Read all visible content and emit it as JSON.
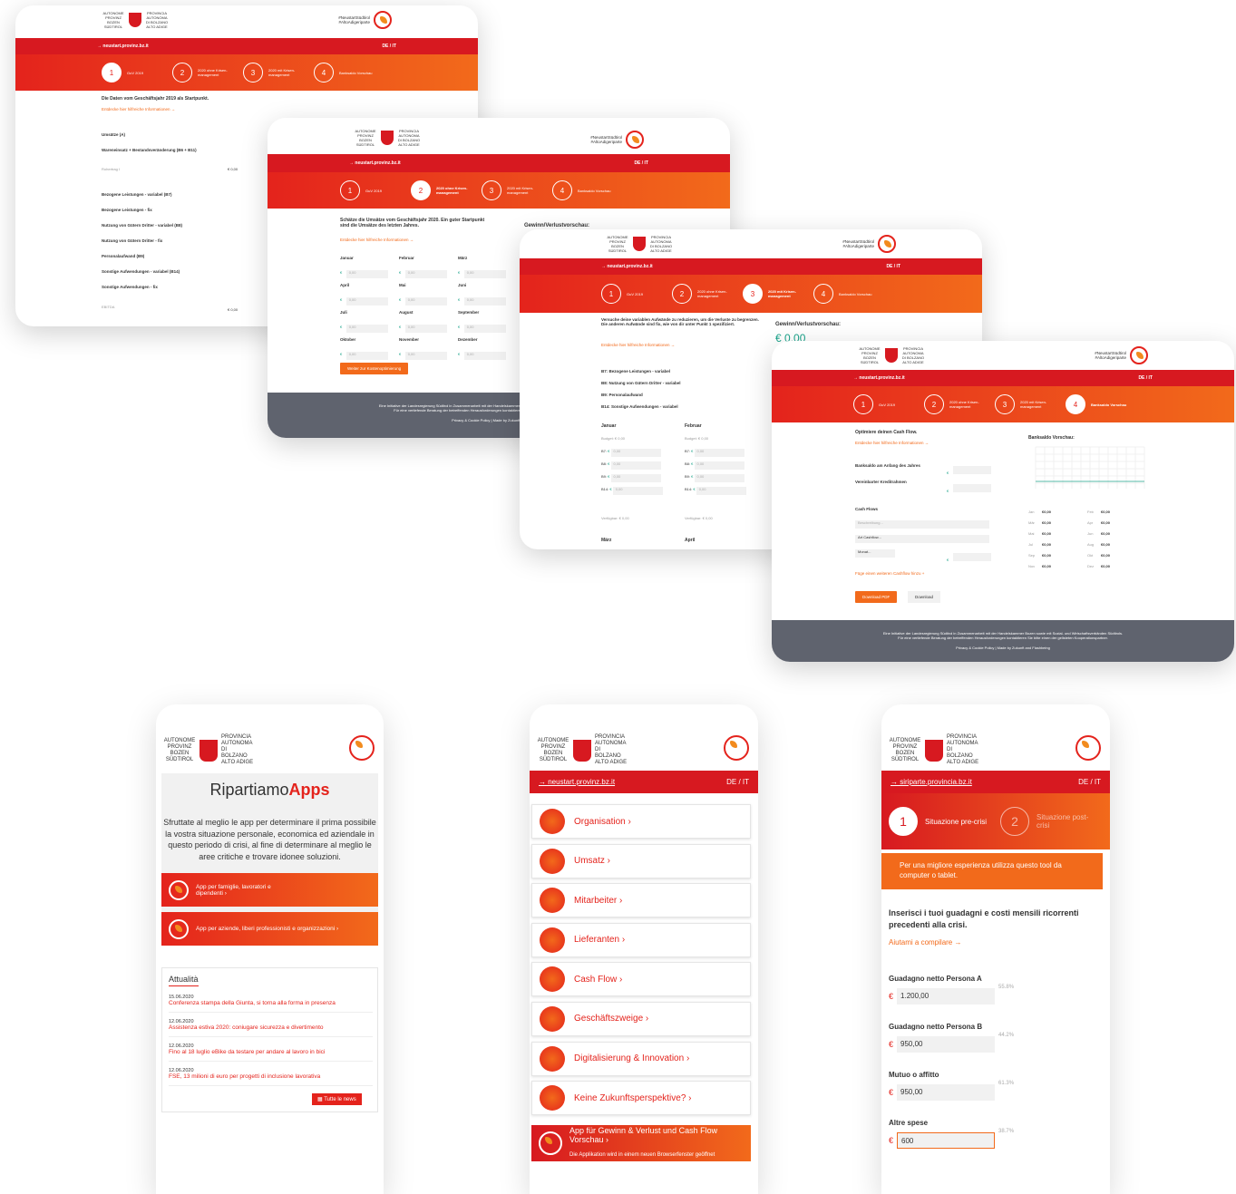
{
  "common": {
    "logo_de": "AUTONOME PROVINZ BOZEN SÜDTIROL",
    "logo_it": "PROVINCIA AUTONOMA DI BOLZANO ALTO ADIGE",
    "brand_line1": "#NeustartSüdtirol",
    "brand_line2": "#AltoAdigeriparte",
    "url": "→ neustart.provinz.bz.it",
    "lang": "DE / IT",
    "footer1": "Eine Initiative der Landesregierung Südtirol in Zusammenarbeit mit der Handelskammer Bozen sowie mit Sozial- und Wirtschaftsverbänden Südtirols.",
    "footer2": "Für eine vertiefende Beratung der betreffenden Herausforderungen kontaktieren Sie bitte einen der gelisteten Kooperationspartner.",
    "footer3": "Privacy & Cookie Policy | Made by Zukunft and Flashbeing",
    "cur": "€",
    "zero": "0,00",
    "info_link": "Entdecke hier hilfreiche Informationen →"
  },
  "steps": [
    {
      "n": "1",
      "label": "GuV 2019"
    },
    {
      "n": "2",
      "label": "2020 ohne Krisen-management"
    },
    {
      "n": "3",
      "label": "2020 mit Krisen-management"
    },
    {
      "n": "4",
      "label": "Banksaldo Vorschau"
    }
  ],
  "s1": {
    "heading": "Die Daten vom Geschäftsjahr 2019 als Startpunkt.",
    "rows": [
      "Umsätze (A)",
      "Wareneinsatz + Bestandsveränderung (B6 + B11)",
      "Rohertrag I",
      "Bezogene Leistungen - variabel (B7)",
      "Bezogene Leistungen - fix",
      "Nutzung von Gütern Dritter - variabel (B8)",
      "Nutzung von Gütern Dritter - fix",
      "Personalaufwand (B9)",
      "Sonstige Aufwendungen - variabel (B14)",
      "Sonstige Aufwendungen - fix",
      "EBITDA"
    ],
    "total": "€ 0,00"
  },
  "s2": {
    "heading": "Schätze die Umsätze vom Geschäftsjahr 2020. Ein guter Startpunkt sind die Umsätze des letzten Jahres.",
    "preview": "Gewinn/Verlustvorschau:",
    "months": [
      "Januar",
      "Februar",
      "März",
      "April",
      "Mai",
      "Juni",
      "Juli",
      "August",
      "September",
      "Oktober",
      "November",
      "Dezember"
    ],
    "button": "Weiter zur Kostenoptimierung"
  },
  "s3": {
    "heading": "Versuche deine variablen Aufwände zu reduzieren, um die Verluste zu begrenzen. Die anderen Aufwände sind fix, wie von dir unter Punkt 1 spezifiziert.",
    "preview": "Gewinn/Verlustvorschau:",
    "preview_value": "€ 0,00",
    "items": [
      "B7: Bezogene Leistungen - variabel",
      "B8: Nutzung von Gütern Dritter - variabel",
      "B9: Personalaufwand",
      "B14: Sonstige Aufwendungen - variabel"
    ],
    "col1": "Januar",
    "col2": "Februar",
    "budget": "Budget: € 0,00",
    "codes": [
      "B7:",
      "B8:",
      "B9:",
      "B14:"
    ],
    "avail": "Verfügbar: € 0,00",
    "next1": "März",
    "next2": "April"
  },
  "s4": {
    "heading": "Optimiere deinen Cash Flow.",
    "chart_title": "Banksaldo Vorschau:",
    "f1": "Banksaldo am Anfang des Jahres",
    "f2": "Vereinbarter Kreditrahmen",
    "cf": "Cash Flows",
    "desc": "Beschreibung...",
    "art": "Art Cashflow...",
    "monat": "Monat...",
    "add": "Füge einen weiteren Cashflow hinzu +",
    "pdf": "Download PDF",
    "dl": "Download",
    "months": [
      [
        "Jan",
        "€0,00",
        "Feb",
        "€0,00"
      ],
      [
        "Mär",
        "€0,00",
        "Apr",
        "€0,00"
      ],
      [
        "Mai",
        "€0,00",
        "Jun",
        "€0,00"
      ],
      [
        "Jul",
        "€0,00",
        "Aug",
        "€0,00"
      ],
      [
        "Sep",
        "€0,00",
        "Okt",
        "€0,00"
      ],
      [
        "Nov",
        "€0,00",
        "Dez",
        "€0,00"
      ]
    ]
  },
  "m1": {
    "title_a": "Ripartiamo",
    "title_b": "Apps",
    "intro": "Sfruttate al meglio le app per determinare il prima possibile la vostra situazione personale, economica ed aziendale in questo periodo di crisi, al fine di determinare al meglio le aree critiche e trovare idonee soluzioni.",
    "app1": "App per famiglie, lavoratori e dipendenti ›",
    "app2": "App per aziende, liberi professionisti e organizzazioni ›",
    "news_title": "Attualità",
    "news": [
      {
        "d": "15.06.2020",
        "t": "Conferenza stampa della Giunta, si torna alla forma in presenza"
      },
      {
        "d": "12.06.2020",
        "t": "Assistenza estiva 2020: coniugare sicurezza e divertimento"
      },
      {
        "d": "12.06.2020",
        "t": "Fino al 18 luglio eBike da testare per andare al lavoro in bici"
      },
      {
        "d": "12.06.2020",
        "t": "FSE, 13 milioni di euro per progetti di inclusione lavorativa"
      }
    ],
    "all": "Tutte le news"
  },
  "m2": {
    "url": "→ neustart.provinz.bz.it",
    "lang": "DE / IT",
    "items": [
      "Organisation ›",
      "Umsatz ›",
      "Mitarbeiter ›",
      "Lieferanten ›",
      "Cash Flow ›",
      "Geschäftszweige ›",
      "Digitalisierung & Innovation ›",
      "Keine Zukunftsperspektive? ›"
    ],
    "cta1": "App für Gewinn & Verlust und Cash Flow Vorschau ›",
    "cta2": "Die Applikation wird in einem neuen Browserfenster geöffnet"
  },
  "m3": {
    "url": "→ siriparte.provincia.bz.it",
    "lang": "DE / IT",
    "st1": "Situazione pre-crisi",
    "st2": "Situazione post-crisi",
    "notice": "Per una migliore esperienza utilizza questo tool da computer o tablet.",
    "heading": "Inserisci i tuoi guadagni e costi mensili ricorrenti precedenti alla crisi.",
    "help": "Aiutami a compilare →",
    "fields": [
      {
        "l": "Guadagno netto Persona A",
        "v": "1.200,00",
        "p": "55.8%"
      },
      {
        "l": "Guadagno netto Persona B",
        "v": "950,00",
        "p": "44.2%"
      },
      {
        "l": "Mutuo o affitto",
        "v": "950,00",
        "p": "61.3%"
      },
      {
        "l": "Altre spese",
        "v": "600",
        "p": "38.7%"
      }
    ]
  }
}
